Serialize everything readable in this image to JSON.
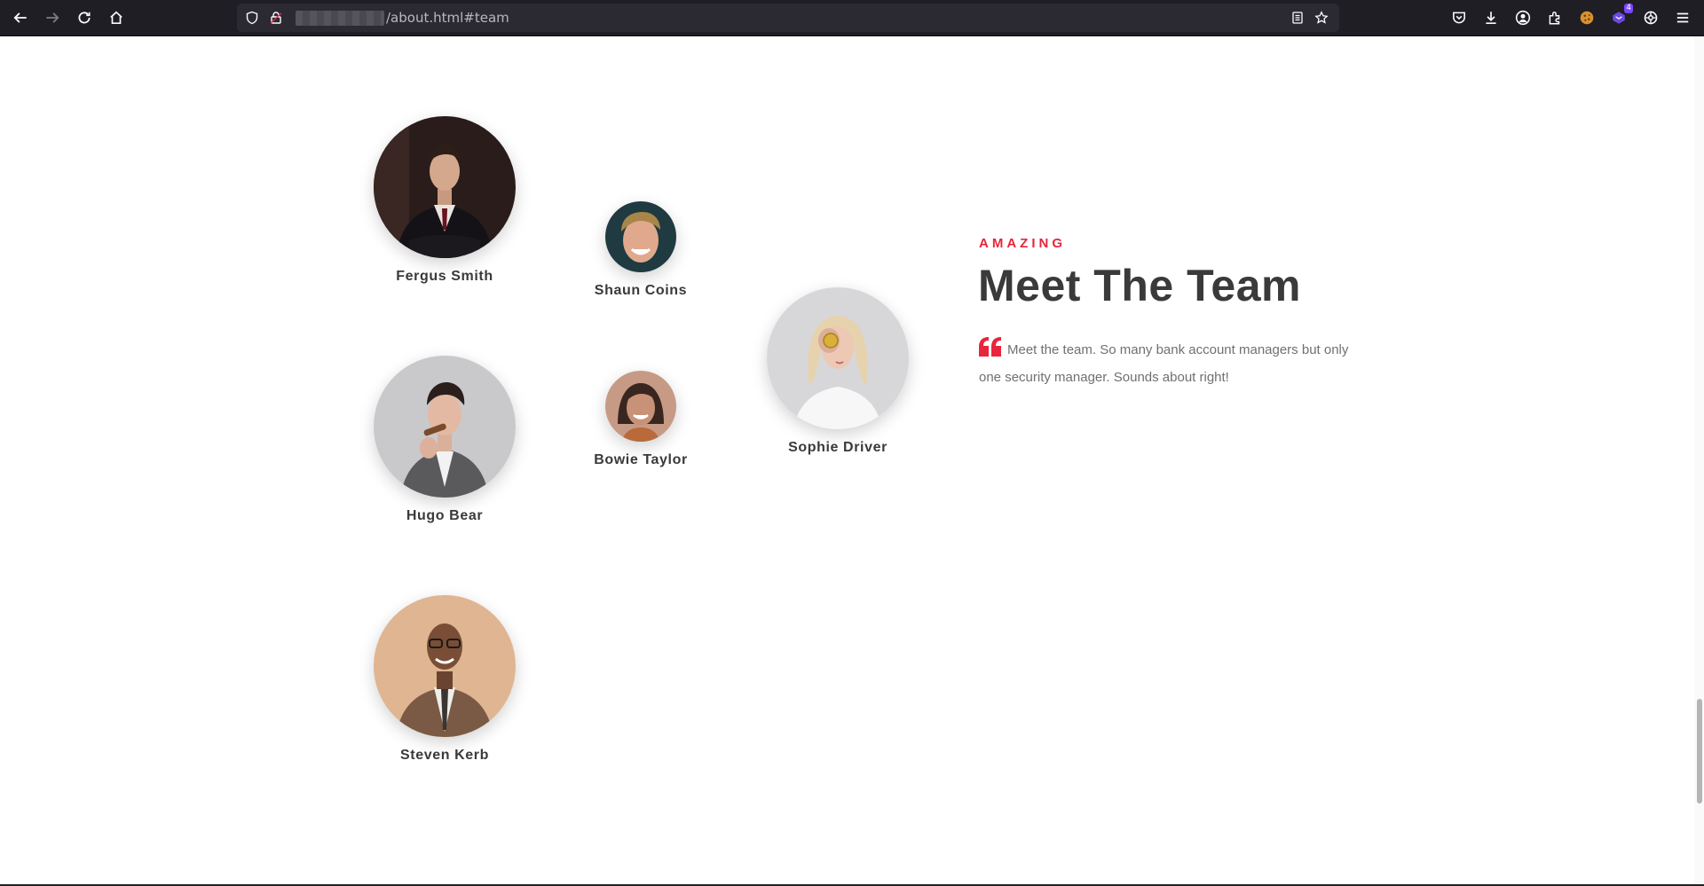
{
  "browser": {
    "url_path": "/about.html#team",
    "extensions_badge": "4",
    "icons": [
      "back-icon",
      "forward-icon",
      "reload-icon",
      "home-icon",
      "shield-icon",
      "lock-icon",
      "reader-view-icon",
      "bookmark-star-icon",
      "pocket-icon",
      "download-icon",
      "account-icon",
      "extensions-icon",
      "cookie-icon",
      "extension-badge-icon",
      "settings-icon",
      "menu-icon"
    ]
  },
  "section": {
    "eyebrow": "AMAZING",
    "title": "Meet The Team",
    "quote": "Meet the team. So many bank account managers but only one security manager. Sounds about right!",
    "accent_color": "#e8253c",
    "heading_color": "#3a3a3a"
  },
  "team": [
    {
      "name": "Fergus Smith"
    },
    {
      "name": "Hugo Bear"
    },
    {
      "name": "Steven Kerb"
    },
    {
      "name": "Shaun Coins"
    },
    {
      "name": "Bowie Taylor"
    },
    {
      "name": "Sophie Driver"
    }
  ]
}
